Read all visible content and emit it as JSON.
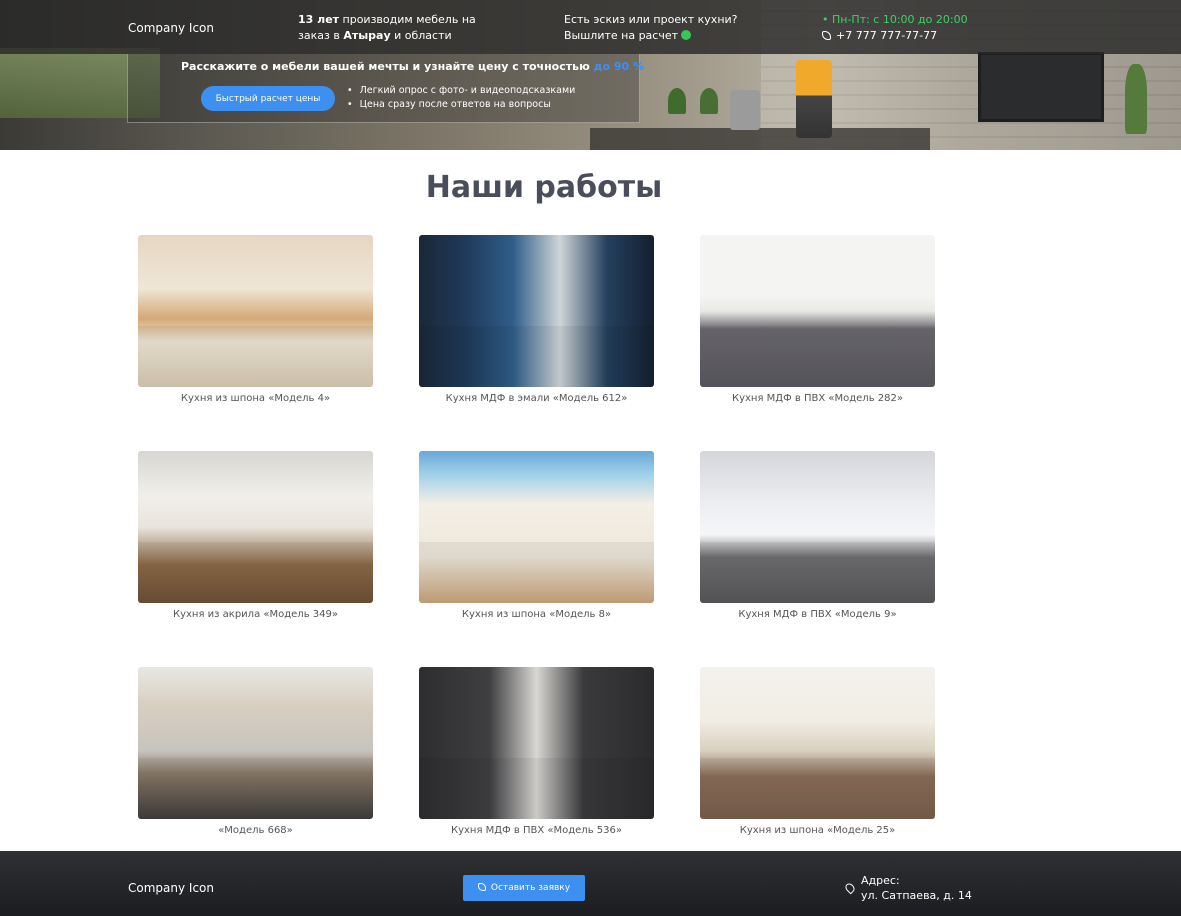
{
  "header": {
    "logo": "Company Icon",
    "tagline_bold": "13 лет",
    "tagline_part1": " производим мебель на заказ в ",
    "tagline_city": "Атырау",
    "tagline_part2": " и области",
    "sketch_line1": "Есть эскиз или проект кухни?",
    "sketch_line2": "Вышлите на расчет",
    "hours": "• Пн-Пт: с 10:00 до 20:00",
    "phone": "+7 777 777-77-77"
  },
  "promo": {
    "title": "Расскажите о мебели вашей мечты и узнайте цену с точностью ",
    "title_accent": "до 90 %",
    "button_label": "Быстрый расчет цены",
    "bullets": [
      "Легкий опрос с фото- и видеоподсказками",
      "Цена сразу после ответов на вопросы"
    ]
  },
  "works": {
    "title": "Наши работы",
    "items": [
      {
        "caption": "Кухня из шпона «Модель 4»"
      },
      {
        "caption": "Кухня МДФ в эмали «Модель 612»"
      },
      {
        "caption": "Кухня МДФ в ПВХ «Модель 282»"
      },
      {
        "caption": "Кухня из акрила «Модель 349»"
      },
      {
        "caption": "Кухня из шпона «Модель 8»"
      },
      {
        "caption": "Кухня МДФ в ПВХ «Модель 9»"
      },
      {
        "caption": "«Модель 668»"
      },
      {
        "caption": "Кухня МДФ в ПВХ «Модель 536»"
      },
      {
        "caption": "Кухня из шпона «Модель 25»"
      }
    ]
  },
  "footer": {
    "logo": "Company Icon",
    "button_label": "Оставить заявку",
    "address_label": "Адрес:",
    "address_value": "ул. Сатпаева, д. 14"
  },
  "icons": {
    "whatsapp": "whatsapp-icon",
    "phone": "phone-icon",
    "location": "location-pin-icon"
  },
  "colors": {
    "accent": "#3d8ff0",
    "hours_green": "#3dd164",
    "title": "#4a4e5a"
  }
}
